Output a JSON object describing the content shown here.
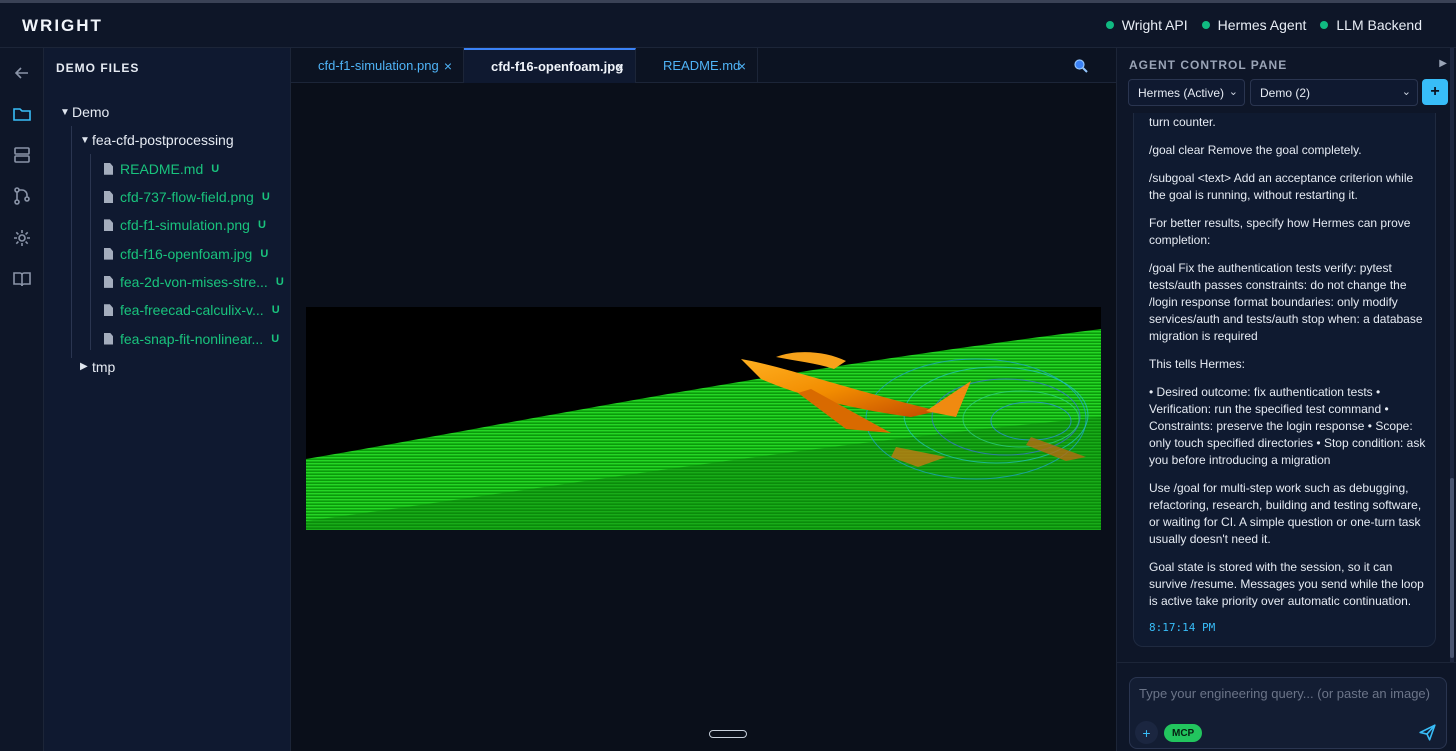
{
  "app": {
    "title": "WRIGHT"
  },
  "status": [
    {
      "label": "Wright API",
      "color": "#10b981"
    },
    {
      "label": "Hermes Agent",
      "color": "#10b981"
    },
    {
      "label": "LLM Backend",
      "color": "#10b981"
    }
  ],
  "rail": {
    "icons": [
      "back-arrow-icon",
      "folder-icon",
      "database-icon",
      "git-branch-icon",
      "gear-icon",
      "book-icon"
    ]
  },
  "sidebar": {
    "title": "DEMO FILES",
    "root": "Demo",
    "folder": "fea-cfd-postprocessing",
    "files": [
      {
        "name": "README.md",
        "status": "U"
      },
      {
        "name": "cfd-737-flow-field.png",
        "status": "U"
      },
      {
        "name": "cfd-f1-simulation.png",
        "status": "U"
      },
      {
        "name": "cfd-f16-openfoam.jpg",
        "status": "U"
      },
      {
        "name": "fea-2d-von-mises-stre...",
        "status": "U"
      },
      {
        "name": "fea-freecad-calculix-v...",
        "status": "U"
      },
      {
        "name": "fea-snap-fit-nonlinear...",
        "status": "U"
      }
    ],
    "tmp_folder": "tmp"
  },
  "tabs": [
    {
      "label": "cfd-f1-simulation.png",
      "active": false
    },
    {
      "label": "cfd-f16-openfoam.jpg",
      "active": true
    },
    {
      "label": "README.md",
      "active": false
    }
  ],
  "tab_close": "×",
  "agent": {
    "title": "AGENT CONTROL PANE",
    "agent_select": "Hermes (Active)",
    "session_select": "Demo (2)",
    "message": [
      "turn counter.",
      "/goal clear Remove the goal completely.",
      "/subgoal <text> Add an acceptance criterion while the goal is running, without restarting it.",
      "For better results, specify how Hermes can prove completion:",
      "/goal Fix the authentication tests verify: pytest tests/auth passes constraints: do not change the /login response format boundaries: only modify services/auth and tests/auth stop when: a database migration is required",
      "This tells Hermes:",
      "• Desired outcome: fix authentication tests • Verification: run the specified test command • Constraints: preserve the login response • Scope: only touch specified directories • Stop condition: ask you before introducing a migration",
      "Use /goal for multi-step work such as debugging, refactoring, research, building and testing software, or waiting for CI. A simple question or one-turn task usually doesn't need it.",
      "Goal state is stored with the session, so it can survive /resume. Messages you send while the loop is active take priority over automatic continuation."
    ],
    "timestamp": "8:17:14 PM",
    "input_placeholder": "Type your engineering query... (or paste an image)",
    "mcp_label": "MCP"
  }
}
